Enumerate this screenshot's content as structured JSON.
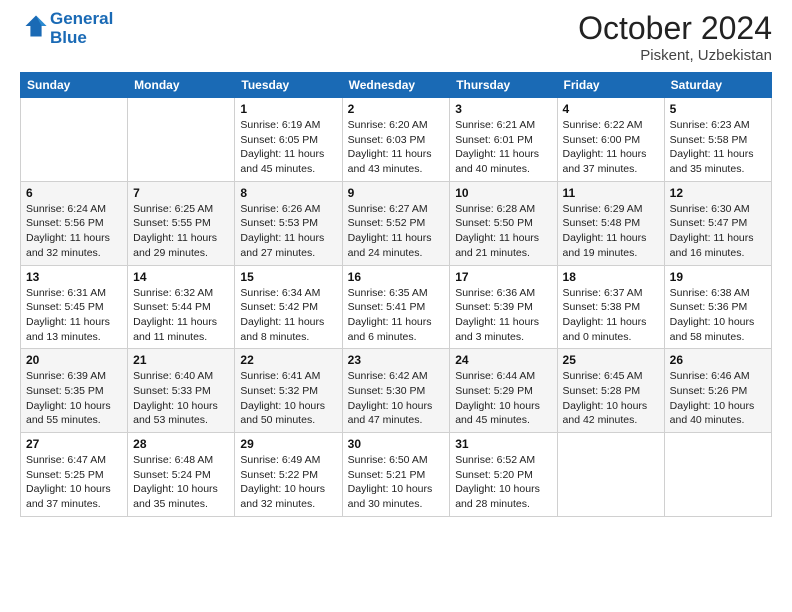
{
  "header": {
    "logo_line1": "General",
    "logo_line2": "Blue",
    "month": "October 2024",
    "location": "Piskent, Uzbekistan"
  },
  "weekdays": [
    "Sunday",
    "Monday",
    "Tuesday",
    "Wednesday",
    "Thursday",
    "Friday",
    "Saturday"
  ],
  "weeks": [
    [
      {
        "day": "",
        "sunrise": "",
        "sunset": "",
        "daylight": ""
      },
      {
        "day": "",
        "sunrise": "",
        "sunset": "",
        "daylight": ""
      },
      {
        "day": "1",
        "sunrise": "Sunrise: 6:19 AM",
        "sunset": "Sunset: 6:05 PM",
        "daylight": "Daylight: 11 hours and 45 minutes."
      },
      {
        "day": "2",
        "sunrise": "Sunrise: 6:20 AM",
        "sunset": "Sunset: 6:03 PM",
        "daylight": "Daylight: 11 hours and 43 minutes."
      },
      {
        "day": "3",
        "sunrise": "Sunrise: 6:21 AM",
        "sunset": "Sunset: 6:01 PM",
        "daylight": "Daylight: 11 hours and 40 minutes."
      },
      {
        "day": "4",
        "sunrise": "Sunrise: 6:22 AM",
        "sunset": "Sunset: 6:00 PM",
        "daylight": "Daylight: 11 hours and 37 minutes."
      },
      {
        "day": "5",
        "sunrise": "Sunrise: 6:23 AM",
        "sunset": "Sunset: 5:58 PM",
        "daylight": "Daylight: 11 hours and 35 minutes."
      }
    ],
    [
      {
        "day": "6",
        "sunrise": "Sunrise: 6:24 AM",
        "sunset": "Sunset: 5:56 PM",
        "daylight": "Daylight: 11 hours and 32 minutes."
      },
      {
        "day": "7",
        "sunrise": "Sunrise: 6:25 AM",
        "sunset": "Sunset: 5:55 PM",
        "daylight": "Daylight: 11 hours and 29 minutes."
      },
      {
        "day": "8",
        "sunrise": "Sunrise: 6:26 AM",
        "sunset": "Sunset: 5:53 PM",
        "daylight": "Daylight: 11 hours and 27 minutes."
      },
      {
        "day": "9",
        "sunrise": "Sunrise: 6:27 AM",
        "sunset": "Sunset: 5:52 PM",
        "daylight": "Daylight: 11 hours and 24 minutes."
      },
      {
        "day": "10",
        "sunrise": "Sunrise: 6:28 AM",
        "sunset": "Sunset: 5:50 PM",
        "daylight": "Daylight: 11 hours and 21 minutes."
      },
      {
        "day": "11",
        "sunrise": "Sunrise: 6:29 AM",
        "sunset": "Sunset: 5:48 PM",
        "daylight": "Daylight: 11 hours and 19 minutes."
      },
      {
        "day": "12",
        "sunrise": "Sunrise: 6:30 AM",
        "sunset": "Sunset: 5:47 PM",
        "daylight": "Daylight: 11 hours and 16 minutes."
      }
    ],
    [
      {
        "day": "13",
        "sunrise": "Sunrise: 6:31 AM",
        "sunset": "Sunset: 5:45 PM",
        "daylight": "Daylight: 11 hours and 13 minutes."
      },
      {
        "day": "14",
        "sunrise": "Sunrise: 6:32 AM",
        "sunset": "Sunset: 5:44 PM",
        "daylight": "Daylight: 11 hours and 11 minutes."
      },
      {
        "day": "15",
        "sunrise": "Sunrise: 6:34 AM",
        "sunset": "Sunset: 5:42 PM",
        "daylight": "Daylight: 11 hours and 8 minutes."
      },
      {
        "day": "16",
        "sunrise": "Sunrise: 6:35 AM",
        "sunset": "Sunset: 5:41 PM",
        "daylight": "Daylight: 11 hours and 6 minutes."
      },
      {
        "day": "17",
        "sunrise": "Sunrise: 6:36 AM",
        "sunset": "Sunset: 5:39 PM",
        "daylight": "Daylight: 11 hours and 3 minutes."
      },
      {
        "day": "18",
        "sunrise": "Sunrise: 6:37 AM",
        "sunset": "Sunset: 5:38 PM",
        "daylight": "Daylight: 11 hours and 0 minutes."
      },
      {
        "day": "19",
        "sunrise": "Sunrise: 6:38 AM",
        "sunset": "Sunset: 5:36 PM",
        "daylight": "Daylight: 10 hours and 58 minutes."
      }
    ],
    [
      {
        "day": "20",
        "sunrise": "Sunrise: 6:39 AM",
        "sunset": "Sunset: 5:35 PM",
        "daylight": "Daylight: 10 hours and 55 minutes."
      },
      {
        "day": "21",
        "sunrise": "Sunrise: 6:40 AM",
        "sunset": "Sunset: 5:33 PM",
        "daylight": "Daylight: 10 hours and 53 minutes."
      },
      {
        "day": "22",
        "sunrise": "Sunrise: 6:41 AM",
        "sunset": "Sunset: 5:32 PM",
        "daylight": "Daylight: 10 hours and 50 minutes."
      },
      {
        "day": "23",
        "sunrise": "Sunrise: 6:42 AM",
        "sunset": "Sunset: 5:30 PM",
        "daylight": "Daylight: 10 hours and 47 minutes."
      },
      {
        "day": "24",
        "sunrise": "Sunrise: 6:44 AM",
        "sunset": "Sunset: 5:29 PM",
        "daylight": "Daylight: 10 hours and 45 minutes."
      },
      {
        "day": "25",
        "sunrise": "Sunrise: 6:45 AM",
        "sunset": "Sunset: 5:28 PM",
        "daylight": "Daylight: 10 hours and 42 minutes."
      },
      {
        "day": "26",
        "sunrise": "Sunrise: 6:46 AM",
        "sunset": "Sunset: 5:26 PM",
        "daylight": "Daylight: 10 hours and 40 minutes."
      }
    ],
    [
      {
        "day": "27",
        "sunrise": "Sunrise: 6:47 AM",
        "sunset": "Sunset: 5:25 PM",
        "daylight": "Daylight: 10 hours and 37 minutes."
      },
      {
        "day": "28",
        "sunrise": "Sunrise: 6:48 AM",
        "sunset": "Sunset: 5:24 PM",
        "daylight": "Daylight: 10 hours and 35 minutes."
      },
      {
        "day": "29",
        "sunrise": "Sunrise: 6:49 AM",
        "sunset": "Sunset: 5:22 PM",
        "daylight": "Daylight: 10 hours and 32 minutes."
      },
      {
        "day": "30",
        "sunrise": "Sunrise: 6:50 AM",
        "sunset": "Sunset: 5:21 PM",
        "daylight": "Daylight: 10 hours and 30 minutes."
      },
      {
        "day": "31",
        "sunrise": "Sunrise: 6:52 AM",
        "sunset": "Sunset: 5:20 PM",
        "daylight": "Daylight: 10 hours and 28 minutes."
      },
      {
        "day": "",
        "sunrise": "",
        "sunset": "",
        "daylight": ""
      },
      {
        "day": "",
        "sunrise": "",
        "sunset": "",
        "daylight": ""
      }
    ]
  ]
}
